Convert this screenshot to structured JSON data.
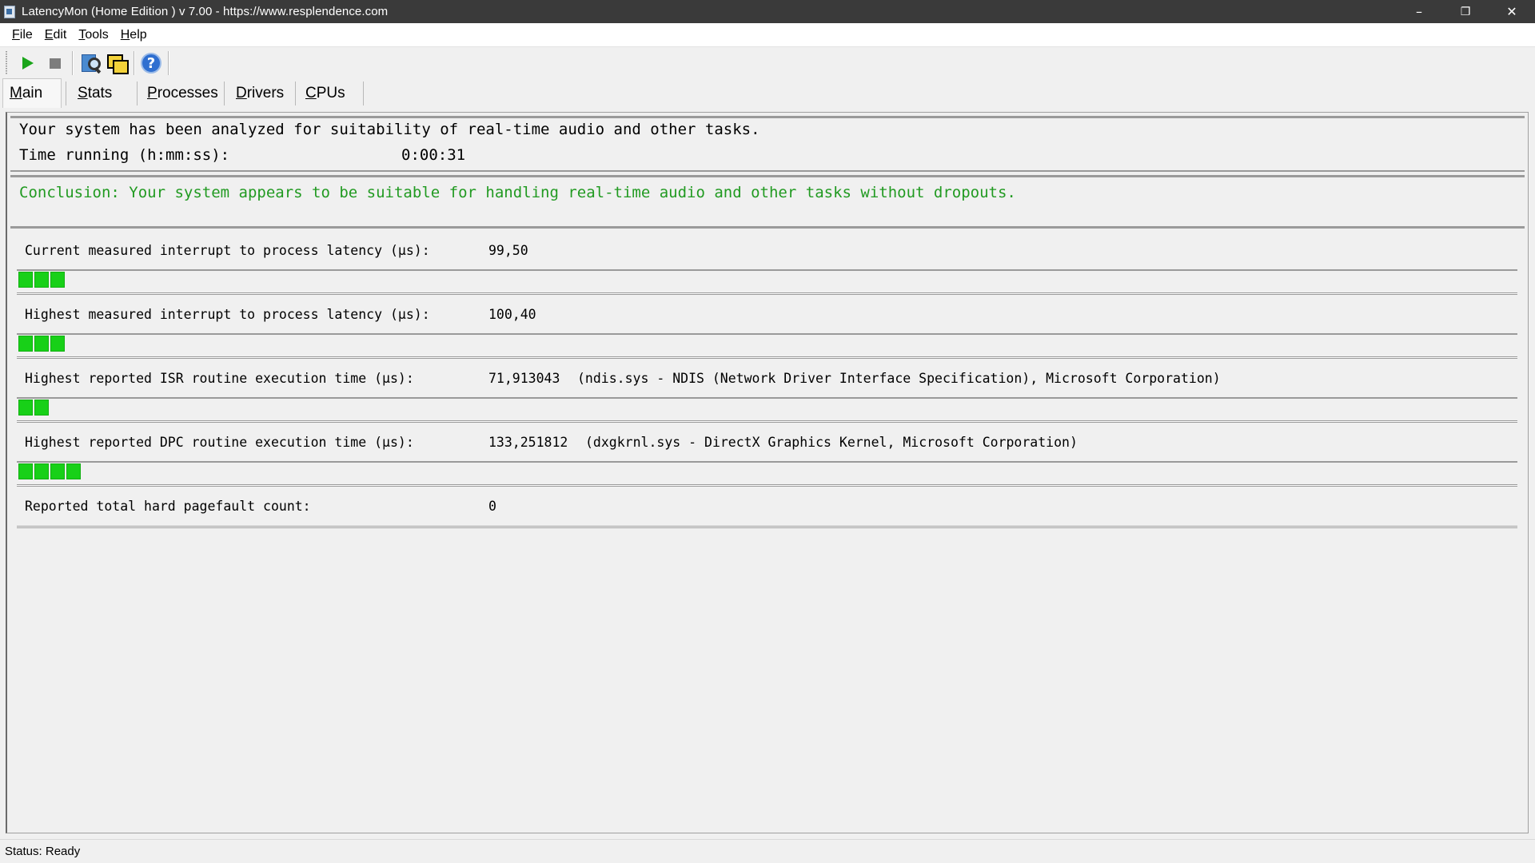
{
  "window": {
    "title": "LatencyMon  (Home Edition )  v 7.00 - https://www.resplendence.com",
    "controls": {
      "minimize": "–",
      "restore": "❐",
      "close": "✕"
    }
  },
  "menu": [
    {
      "accel": "F",
      "rest": "ile"
    },
    {
      "accel": "E",
      "rest": "dit"
    },
    {
      "accel": "T",
      "rest": "ools"
    },
    {
      "accel": "H",
      "rest": "elp"
    }
  ],
  "toolbar": {
    "icons": [
      "play-icon",
      "stop-icon",
      "search-icon",
      "windows-icon",
      "help-icon"
    ],
    "help_glyph": "?"
  },
  "tabs": [
    {
      "accel": "M",
      "rest": "ain",
      "active": true
    },
    {
      "accel": "S",
      "rest": "tats",
      "active": false
    },
    {
      "accel": "P",
      "rest": "rocesses",
      "active": false
    },
    {
      "accel": "D",
      "rest": "rivers",
      "active": false
    },
    {
      "accel": "C",
      "rest": "PUs",
      "active": false
    }
  ],
  "summary": {
    "analyzed": "Your system has been analyzed for suitability of real-time audio and other tasks.",
    "time_label": "Time running (h:mm:ss):",
    "time_value": "0:00:31"
  },
  "conclusion": {
    "text": "Conclusion: Your system appears to be suitable for handling real-time audio and other tasks without dropouts.",
    "color": "#219a21"
  },
  "metrics": [
    {
      "label": "Current measured interrupt to process latency (µs):",
      "value": "99,50",
      "detail": "",
      "bar_segments": 3
    },
    {
      "label": "Highest measured interrupt to process latency (µs):",
      "value": "100,40",
      "detail": "",
      "bar_segments": 3
    },
    {
      "label": "Highest reported ISR routine execution time (µs):",
      "value": "71,913043",
      "detail": "(ndis.sys - NDIS (Network Driver Interface Specification), Microsoft Corporation)",
      "bar_segments": 2
    },
    {
      "label": "Highest reported DPC routine execution time (µs):",
      "value": "133,251812",
      "detail": "(dxgkrnl.sys - DirectX Graphics Kernel, Microsoft Corporation)",
      "bar_segments": 4
    },
    {
      "label": "Reported total hard pagefault count:",
      "value": "0",
      "detail": "",
      "bar_segments": 0
    }
  ],
  "bar_color": "#18d018",
  "status": "Status: Ready"
}
